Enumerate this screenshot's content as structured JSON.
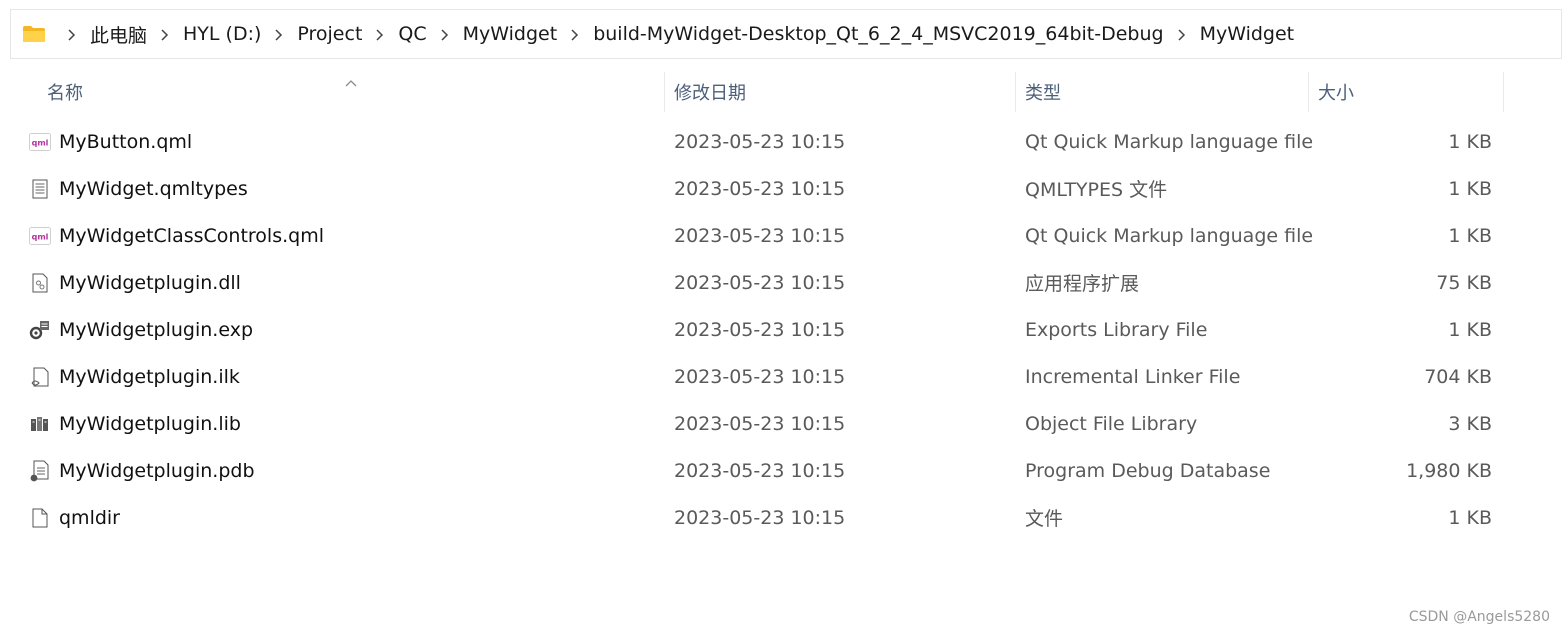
{
  "address": {
    "folder_icon": "folder-icon",
    "crumbs": [
      "此电脑",
      "HYL (D:)",
      "Project",
      "QC",
      "MyWidget",
      "build-MyWidget-Desktop_Qt_6_2_4_MSVC2019_64bit-Debug",
      "MyWidget"
    ]
  },
  "columns": {
    "name": "名称",
    "date": "修改日期",
    "type": "类型",
    "size": "大小"
  },
  "files": [
    {
      "icon": "qml-file-icon",
      "name": "MyButton.qml",
      "date": "2023-05-23 10:15",
      "type": "Qt Quick Markup language file",
      "size": "1 KB"
    },
    {
      "icon": "text-file-icon",
      "name": "MyWidget.qmltypes",
      "date": "2023-05-23 10:15",
      "type": "QMLTYPES 文件",
      "size": "1 KB"
    },
    {
      "icon": "qml-file-icon",
      "name": "MyWidgetClassControls.qml",
      "date": "2023-05-23 10:15",
      "type": "Qt Quick Markup language file",
      "size": "1 KB"
    },
    {
      "icon": "dll-file-icon",
      "name": "MyWidgetplugin.dll",
      "date": "2023-05-23 10:15",
      "type": "应用程序扩展",
      "size": "75 KB"
    },
    {
      "icon": "exp-file-icon",
      "name": "MyWidgetplugin.exp",
      "date": "2023-05-23 10:15",
      "type": "Exports Library File",
      "size": "1 KB"
    },
    {
      "icon": "ilk-file-icon",
      "name": "MyWidgetplugin.ilk",
      "date": "2023-05-23 10:15",
      "type": "Incremental Linker File",
      "size": "704 KB"
    },
    {
      "icon": "lib-file-icon",
      "name": "MyWidgetplugin.lib",
      "date": "2023-05-23 10:15",
      "type": "Object File Library",
      "size": "3 KB"
    },
    {
      "icon": "pdb-file-icon",
      "name": "MyWidgetplugin.pdb",
      "date": "2023-05-23 10:15",
      "type": "Program Debug Database",
      "size": "1,980 KB"
    },
    {
      "icon": "blank-file-icon",
      "name": "qmldir",
      "date": "2023-05-23 10:15",
      "type": "文件",
      "size": "1 KB"
    }
  ],
  "watermark": "CSDN @Angels5280"
}
